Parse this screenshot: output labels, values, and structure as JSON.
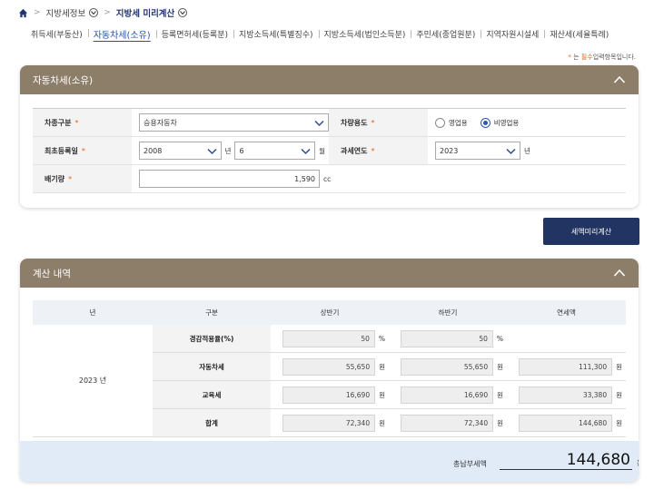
{
  "breadcrumb": {
    "level1": "지방세정보",
    "level2": "지방세 미리계산"
  },
  "tabs": [
    {
      "label": "취득세(부동산)",
      "active": false
    },
    {
      "label": "자동차세(소유)",
      "active": true
    },
    {
      "label": "등록면허세(등록분)",
      "active": false
    },
    {
      "label": "지방소득세(특별징수)",
      "active": false
    },
    {
      "label": "지방소득세(법인소득분)",
      "active": false
    },
    {
      "label": "주민세(종업원분)",
      "active": false
    },
    {
      "label": "지역자원시설세",
      "active": false
    },
    {
      "label": "재산세(세율특례)",
      "active": false
    }
  ],
  "required_note": {
    "star": "*",
    "prefix": "는",
    "required_word": "필수",
    "suffix": "입력항목입니다."
  },
  "vehicle_panel": {
    "title": "자동차세(소유)",
    "fields": {
      "vehicle_type": {
        "label": "차종구분",
        "value": "승용자동차"
      },
      "vehicle_use": {
        "label": "차량용도",
        "options": [
          "영업용",
          "비영업용"
        ],
        "selected": "비영업용"
      },
      "first_registration": {
        "label": "최초등록일",
        "year": "2008",
        "year_unit": "년",
        "month": "6",
        "month_unit": "월"
      },
      "tax_year": {
        "label": "과세연도",
        "value": "2023",
        "unit": "년"
      },
      "displacement": {
        "label": "배기량",
        "value": "1,590",
        "unit": "cc"
      }
    },
    "required_star": "*"
  },
  "calc_button": {
    "label": "세액미리계산"
  },
  "result_panel": {
    "title": "계산 내역",
    "columns": [
      "년",
      "구분",
      "상반기",
      "하반기",
      "연세액"
    ],
    "year": "2023 년",
    "rows": [
      {
        "label": "경감적용율(%)",
        "first_half": "50",
        "second_half": "50",
        "annual": "",
        "unit": "%"
      },
      {
        "label": "자동차세",
        "first_half": "55,650",
        "second_half": "55,650",
        "annual": "111,300",
        "unit": "원"
      },
      {
        "label": "교육세",
        "first_half": "16,690",
        "second_half": "16,690",
        "annual": "33,380",
        "unit": "원"
      },
      {
        "label": "합계",
        "first_half": "72,340",
        "second_half": "72,340",
        "annual": "144,680",
        "unit": "원"
      }
    ],
    "total": {
      "label": "총납부세액",
      "value": "144,680",
      "unit": "원"
    }
  },
  "colors": {
    "panel_header": "#8d7e6a",
    "button": "#213462",
    "active_tab": "#2152a8",
    "required": "#e8611a",
    "total_bar": "#e0ebf7"
  }
}
